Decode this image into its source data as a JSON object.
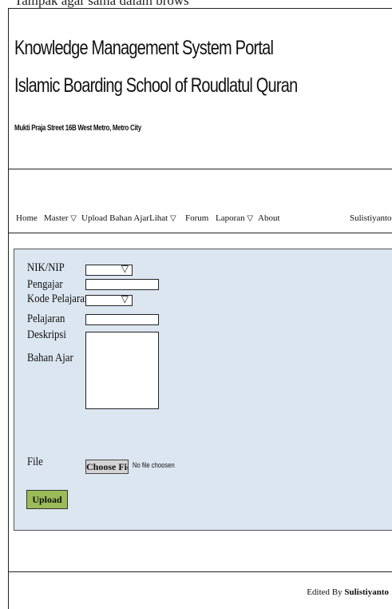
{
  "top_fragment": "Tampak agar sama dalam brows",
  "header": {
    "title_line1": "Knowledge Management System Portal",
    "title_line2": "Islamic Boarding School of Roudlatul Quran",
    "address": "Mukti Praja Street 16B West Metro, Metro City"
  },
  "nav": {
    "items": [
      "Home",
      "Master",
      "Upload Bahan Ajar",
      "Lihat",
      "Forum",
      "Laporan",
      "About"
    ],
    "user": "Sulistiyanto",
    "dropdown_glyph": "▽"
  },
  "form": {
    "labels": {
      "nik": "NIK/NIP",
      "pengajar": "Pengajar",
      "kode": "Kode Pelajaran",
      "pelajaran": "Pelajaran",
      "deskripsi": "Deskripsi",
      "bahan_ajar": "Bahan Ajar",
      "file": "File"
    },
    "values": {
      "nik": "",
      "pengajar": "",
      "kode": "",
      "pelajaran": "",
      "deskripsi": ""
    },
    "choose_button": "Choose Fiel",
    "no_file_text": "No file choosen",
    "upload_button": "Upload"
  },
  "footer": {
    "prefix": "Edited By",
    "author": "Sulistiyanto"
  },
  "colors": {
    "panel_bg": "#dce6f1",
    "upload_btn": "#9bbb59"
  }
}
